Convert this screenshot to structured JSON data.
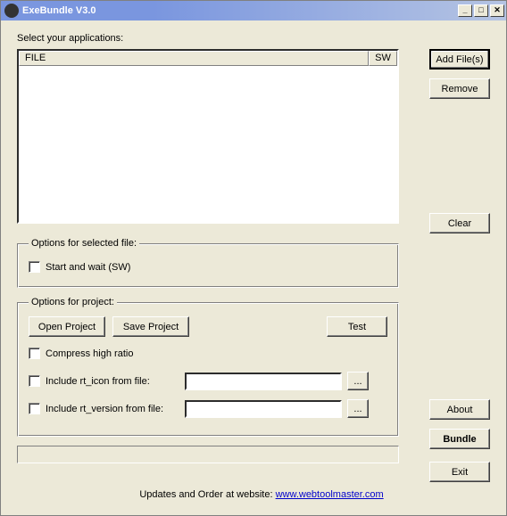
{
  "titlebar": {
    "title": "ExeBundle V3.0"
  },
  "main": {
    "select_label": "Select your applications:",
    "columns": {
      "file": "FILE",
      "sw": "SW"
    }
  },
  "buttons": {
    "add_files": "Add File(s)",
    "remove": "Remove",
    "clear": "Clear",
    "about": "About",
    "bundle": "Bundle",
    "exit": "Exit",
    "browse": "..."
  },
  "group_selected": {
    "legend": "Options for selected file:",
    "start_wait": "Start and wait (SW)"
  },
  "group_project": {
    "legend": "Options for project:",
    "open": "Open Project",
    "save": "Save Project",
    "test": "Test",
    "compress": "Compress high ratio",
    "include_icon": "Include rt_icon from file:",
    "include_version": "Include rt_version from file:",
    "icon_path": "",
    "version_path": ""
  },
  "footer": {
    "text": "Updates and Order at website: ",
    "link_text": "www.webtoolmaster.com"
  }
}
